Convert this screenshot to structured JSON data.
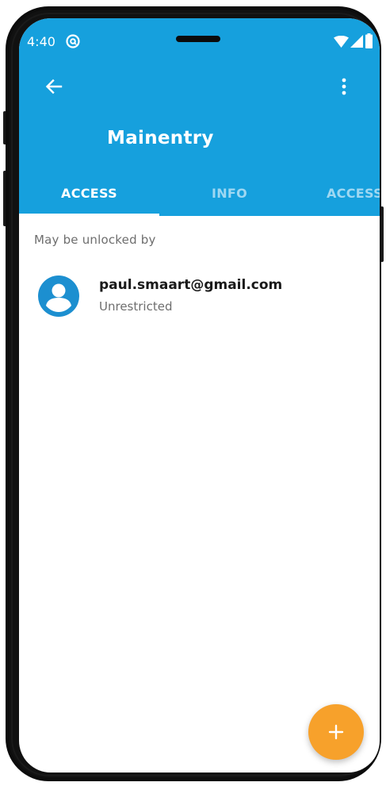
{
  "status_bar": {
    "time": "4:40",
    "notification_icon": "at-sign-circle-icon",
    "wifi_icon": "wifi-icon",
    "signal_icon": "cell-signal-icon",
    "battery_icon": "battery-icon"
  },
  "toolbar": {
    "back_icon": "arrow-left-icon",
    "menu_icon": "more-vertical-icon",
    "title": "Mainentry"
  },
  "tabs": [
    {
      "label": "ACCESS",
      "selected": true
    },
    {
      "label": "INFO",
      "selected": false
    },
    {
      "label": "ACCESS",
      "selected": false
    }
  ],
  "content": {
    "section_header": "May be unlocked by",
    "items": [
      {
        "title": "paul.smaart@gmail.com",
        "subtitle": "Unrestricted",
        "icon": "account-circle-icon"
      }
    ]
  },
  "fab": {
    "icon": "plus-icon",
    "label": "+"
  },
  "colors": {
    "primary": "#16a0dd",
    "accent": "#f7a12b",
    "avatar": "#1c8fd0",
    "tab_inactive": "#9fd8f2"
  }
}
